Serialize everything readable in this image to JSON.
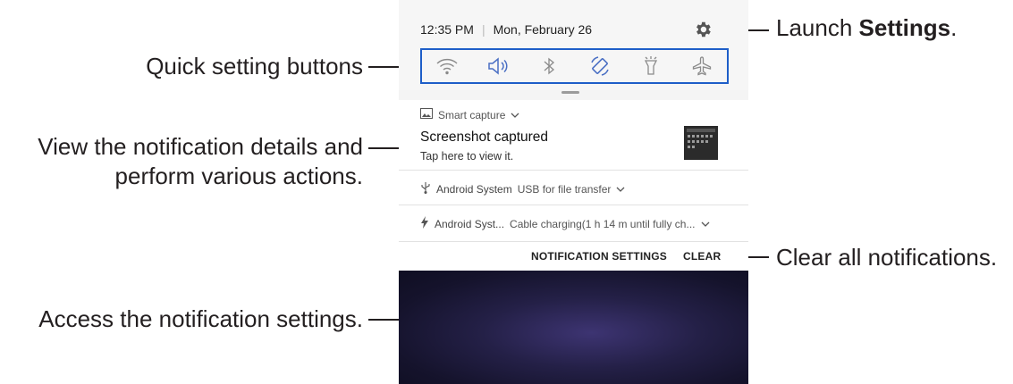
{
  "annotations": {
    "launch_prefix": "Launch ",
    "launch_bold": "Settings",
    "launch_suffix": ".",
    "quick_settings": "Quick setting buttons",
    "details_line1": "View the notification details and",
    "details_line2": "perform various actions.",
    "clear_all": "Clear all notifications.",
    "access_settings": "Access the notification settings."
  },
  "status": {
    "time": "12:35 PM",
    "separator": "|",
    "date": "Mon, February 26"
  },
  "quick_settings": [
    {
      "name": "wifi",
      "icon": "wifi-icon"
    },
    {
      "name": "sound",
      "icon": "sound-icon"
    },
    {
      "name": "bluetooth",
      "icon": "bluetooth-icon"
    },
    {
      "name": "auto-rotate",
      "icon": "auto-rotate-icon"
    },
    {
      "name": "flashlight",
      "icon": "flashlight-icon"
    },
    {
      "name": "airplane-mode",
      "icon": "airplane-icon"
    }
  ],
  "notifications": [
    {
      "app": "Smart capture",
      "title": "Screenshot captured",
      "text": "Tap here to view it."
    },
    {
      "app": "Android System",
      "text": "USB for file transfer"
    },
    {
      "app": "Android Syst...",
      "text": "Cable charging(1 h 14 m until fully ch..."
    }
  ],
  "actions": {
    "notification_settings": "NOTIFICATION SETTINGS",
    "clear": "CLEAR"
  },
  "colors": {
    "highlight": "#1e5ec8",
    "icon": "#8a8a8a",
    "wallpaper": "#1b1936"
  }
}
